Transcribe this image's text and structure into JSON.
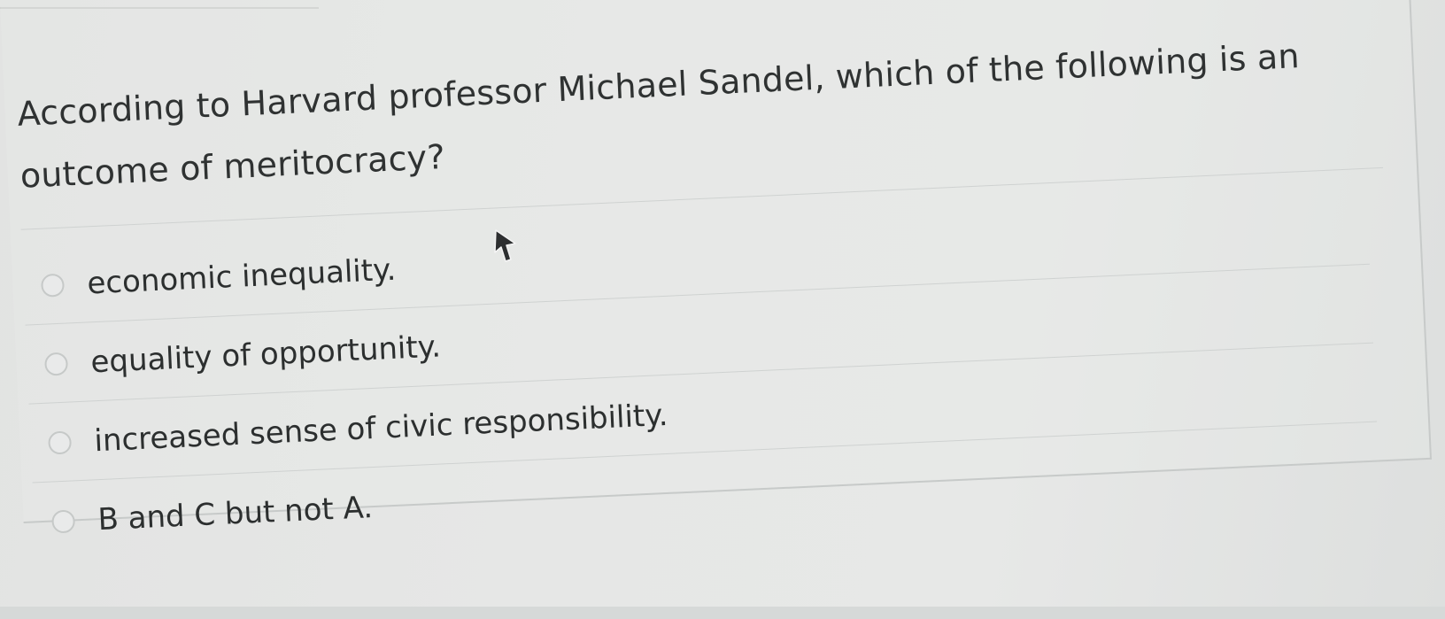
{
  "quiz": {
    "question": "According to Harvard professor Michael Sandel, which of the following is an outcome of meritocracy?",
    "answers": [
      {
        "label": "economic inequality."
      },
      {
        "label": "equality of opportunity."
      },
      {
        "label": "increased sense of civic responsibility."
      },
      {
        "label": "B and C but not A."
      }
    ]
  },
  "icons": {
    "pointer": "mouse-pointer-icon"
  }
}
